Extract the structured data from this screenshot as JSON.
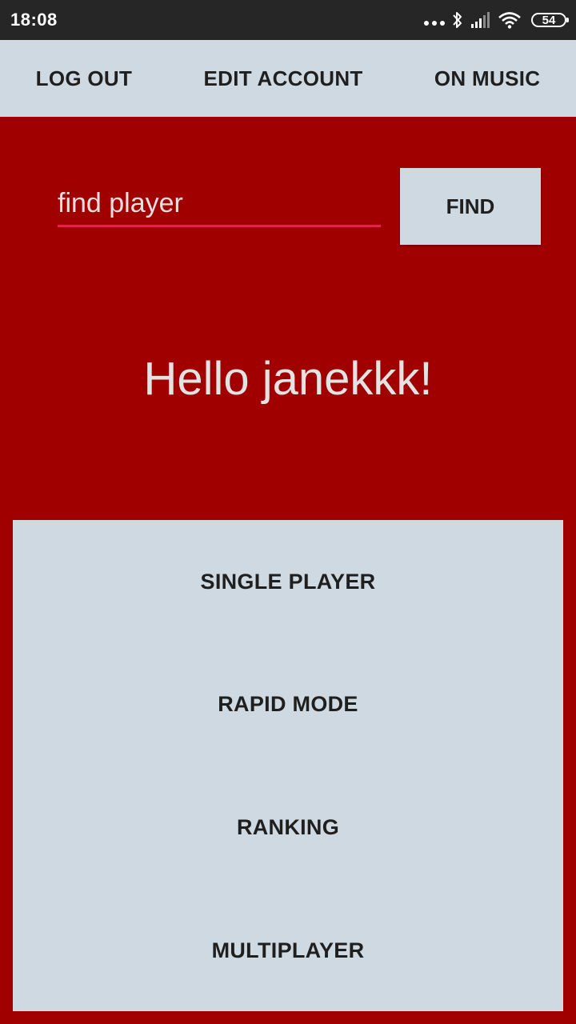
{
  "status_bar": {
    "time": "18:08",
    "battery": "54",
    "icons": [
      "more-dots-icon",
      "bluetooth-icon",
      "signal-icon",
      "wifi-icon",
      "battery-icon"
    ]
  },
  "topnav": {
    "logout": "LOG OUT",
    "edit_account": "EDIT ACCOUNT",
    "music": "ON MUSIC"
  },
  "search": {
    "placeholder": "find player",
    "value": "",
    "button": "FIND"
  },
  "greeting": "Hello janekkk!",
  "menu": {
    "items": [
      {
        "label": "SINGLE PLAYER"
      },
      {
        "label": "RAPID MODE"
      },
      {
        "label": "RANKING"
      },
      {
        "label": "MULTIPLAYER"
      }
    ]
  },
  "colors": {
    "background": "#a00000",
    "panel": "#cfd9e1",
    "accent_underline": "#e91e52",
    "status_bar": "#262626"
  }
}
